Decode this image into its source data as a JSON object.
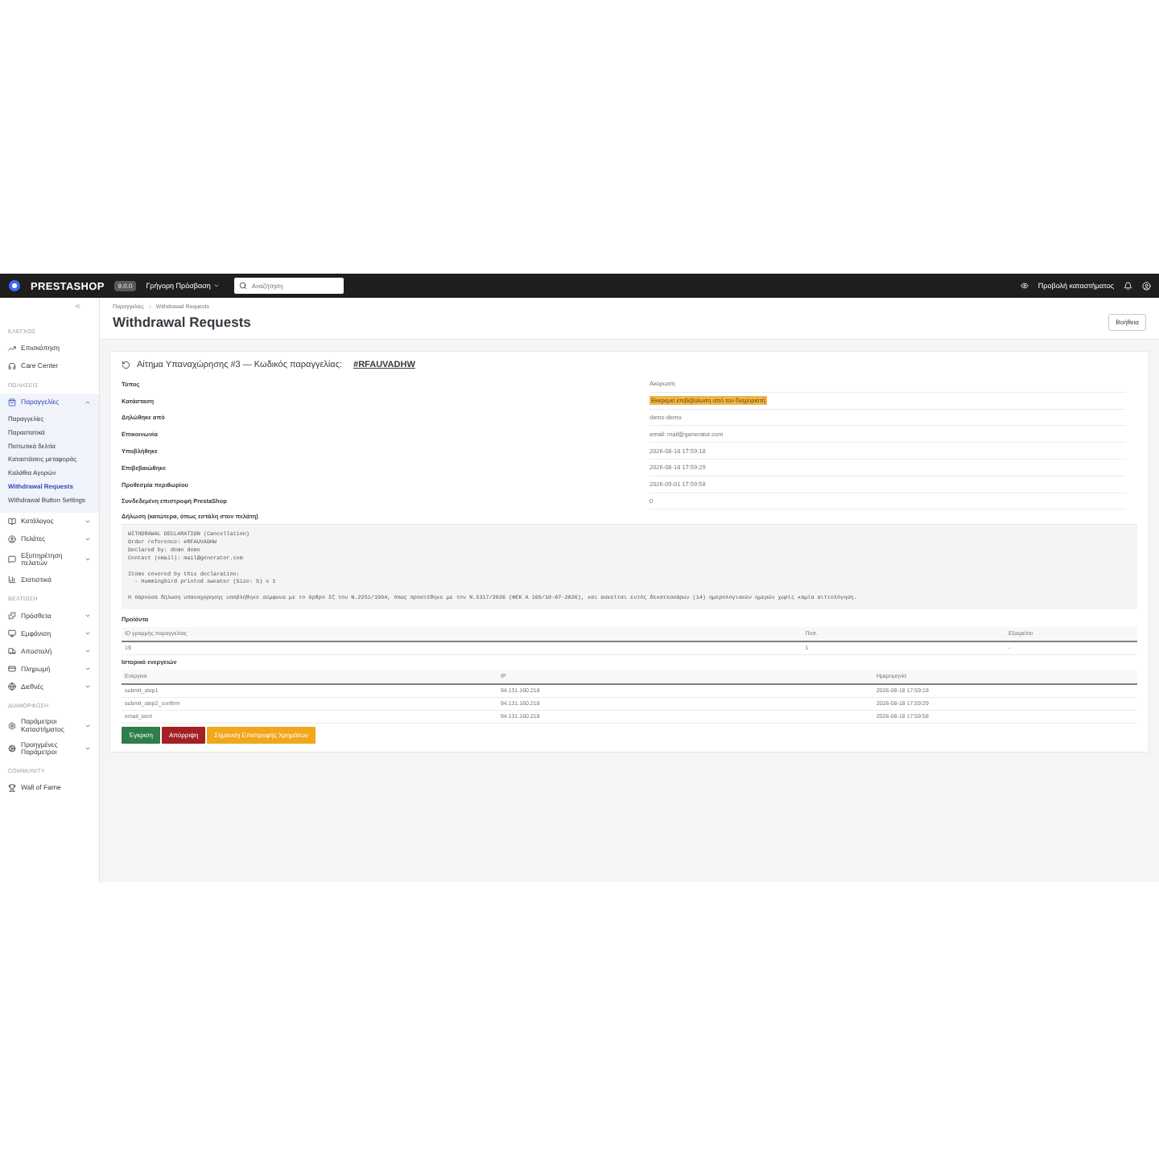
{
  "topbar": {
    "logo": "PRESTASHOP",
    "version": "9.0.0",
    "quick_access": "Γρήγορη Πρόσβαση",
    "search": {
      "placeholder": "Αναζήτηση"
    },
    "view_shop": "Προβολή καταστήματος"
  },
  "sidebar": {
    "sections": [
      {
        "title": "ΕΛΕΓΧΟΣ",
        "items": [
          {
            "label": "Επισκόπηση",
            "selected": false
          },
          {
            "label": "Care Center",
            "selected": false
          }
        ]
      },
      {
        "title": "ΠΩΛΗΣΕΙΣ",
        "items": [
          {
            "label": "Παραγγελίες",
            "selected": true,
            "expanded": true,
            "children": [
              {
                "label": "Παραγγελίες",
                "selected": false
              },
              {
                "label": "Παραστατικά",
                "selected": false
              },
              {
                "label": "Πιστωτικά δελτία",
                "selected": false
              },
              {
                "label": "Καταστάσεις μεταφοράς",
                "selected": false
              },
              {
                "label": "Καλάθια Αγορών",
                "selected": false
              },
              {
                "label": "Withdrawal Requests",
                "selected": true
              },
              {
                "label": "Withdrawal Button Settings",
                "selected": false
              }
            ]
          },
          {
            "label": "Κατάλογος",
            "selected": false,
            "expanded": false
          },
          {
            "label": "Πελάτες",
            "selected": false,
            "expanded": false
          },
          {
            "label": "Εξυπηρέτηση πελατών",
            "selected": false,
            "expanded": false
          },
          {
            "label": "Στατιστικά",
            "selected": false
          }
        ]
      },
      {
        "title": "ΒΕΛΤΙΩΣΗ",
        "items": [
          {
            "label": "Πρόσθετα",
            "selected": false,
            "expanded": false
          },
          {
            "label": "Εμφάνιση",
            "selected": false,
            "expanded": false
          },
          {
            "label": "Αποστολή",
            "selected": false,
            "expanded": false
          },
          {
            "label": "Πληρωμή",
            "selected": false,
            "expanded": false
          },
          {
            "label": "Διεθνές",
            "selected": false,
            "expanded": false
          }
        ]
      },
      {
        "title": "ΔΙΑΜΟΡΦΩΣΗ",
        "items": [
          {
            "label": "Παράμετροι Καταστήματος",
            "selected": false,
            "expanded": false
          },
          {
            "label": "Προηγμένες Παράμετροι",
            "selected": false,
            "expanded": false
          }
        ]
      },
      {
        "title": "COMMUNITY",
        "items": [
          {
            "label": "Wall of Fame",
            "selected": false
          }
        ]
      }
    ]
  },
  "breadcrumb": [
    "Παραγγελίες",
    "Withdrawal Requests"
  ],
  "page_title": "Withdrawal Requests",
  "help_button": "Βοήθεια",
  "card": {
    "title": "Αίτημα Υπαναχώρησης #3 — Κωδικός παραγγελίας:",
    "order_ref": "#RFAUVADHW",
    "fields": [
      {
        "label": "Τύπος",
        "value": "Ακύρωση"
      },
      {
        "label": "Κατάσταση",
        "value": "Εκκρεμεί επιβεβαίωση από τον διαχειριστή",
        "kind": "badge"
      },
      {
        "label": "Δηλώθηκε από",
        "value": "demo demo"
      },
      {
        "label": "Επικοινωνία",
        "value": "email: mail@generator.com"
      },
      {
        "label": "Υποβλήθηκε",
        "value": "2026-08-18 17:59:18"
      },
      {
        "label": "Επιβεβαιώθηκε",
        "value": "2026-08-18 17:59:29"
      },
      {
        "label": "Προθεσμία περιθωρίου",
        "value": "2026-09-01 17:59:58"
      },
      {
        "label": "Συνδεδεμένη επιστροφή PrestaShop",
        "value": "0"
      }
    ],
    "declaration_label": "Δήλωση (κατώτερα, όπως εστάλη στον πελάτη)",
    "declaration": [
      [
        "WITHDRAWAL DECLARATION (Cancellation)",
        "Order reference: #RFAUVADHW",
        "Declared by: demo demo",
        "Contact (email): mail@generator.com"
      ],
      [
        "Items covered by this declaration:",
        "  - Hummingbird printed sweater (Size: S) x 1"
      ],
      [
        "Η παρούσα δήλωση υπαναχώρησης υποβλήθηκε σύμφωνα με το άρθρο 3ζ του Ν.2251/1994, όπως προστέθηκε με τον Ν.5317/2026 (ΦΕΚ Α 109/10-07-2026), και ασκείται εντός δεκατεσσάρων (14) ημερολογιακών ημερών χωρίς καμία αιτιολόγηση."
      ]
    ],
    "products": {
      "title": "Προϊόντα",
      "columns": [
        "ID γραμμής παραγγελίας",
        "Ποσ.",
        "Εξαιρείται"
      ],
      "rows": [
        [
          "19",
          "1",
          "-"
        ]
      ]
    },
    "history": {
      "title": "Ιστορικό ενεργειών",
      "columns": [
        "Ενέργεια",
        "IP",
        "Ημερομηνία"
      ],
      "rows": [
        [
          "submit_step1",
          "94.131.160.218",
          "2026-08-18 17:59:18"
        ],
        [
          "submit_step2_confirm",
          "94.131.160.218",
          "2026-08-18 17:59:29"
        ],
        [
          "email_sent",
          "94.131.160.218",
          "2026-08-18 17:59:58"
        ]
      ]
    },
    "actions": [
      {
        "label": "Έγκριση",
        "kind": "approve"
      },
      {
        "label": "Απόρριψη",
        "kind": "reject"
      },
      {
        "label": "Σήμανση Επιστροφής Χρημάτων",
        "kind": "refund"
      }
    ]
  }
}
